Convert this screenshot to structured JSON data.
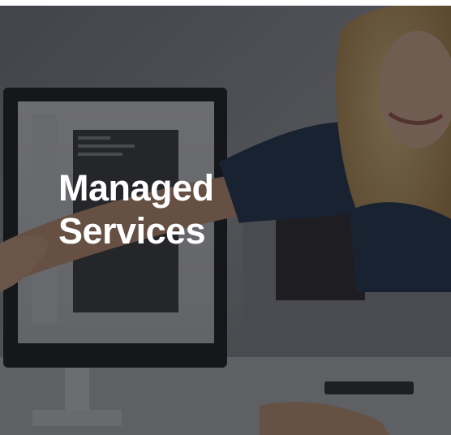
{
  "tile": {
    "title_line1": "Managed",
    "title_line2": "Services"
  },
  "colors": {
    "overlay": "#141418",
    "title_text": "#ffffff"
  }
}
